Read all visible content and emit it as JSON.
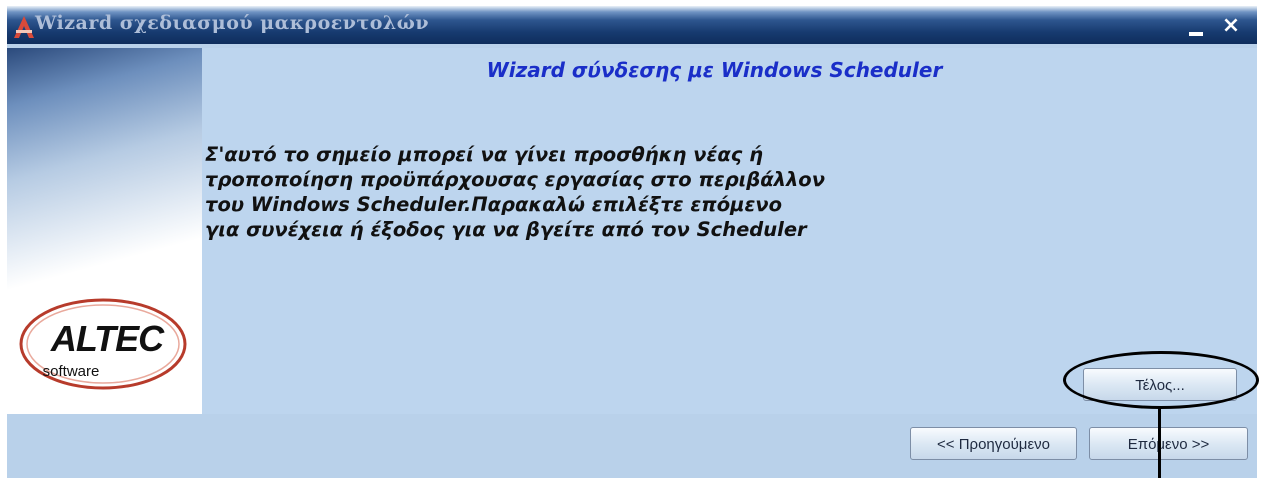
{
  "window": {
    "title": "Wizard σχεδιασμού μακροεντολών",
    "minimize_icon": "minimize-icon",
    "close_icon": "close-icon",
    "close_glyph": "×"
  },
  "logo": {
    "brand": "ALTEC",
    "sub": "software",
    "accent_color": "#c0392b"
  },
  "main": {
    "heading": "Wizard σύνδεσης με Windows Scheduler",
    "body_lines": [
      "Σ'αυτό το σημείο μπορεί να γίνει προσθήκη νέας ή",
      "τροποποίηση προϋπάρχουσας εργασίας στο περιβάλλον",
      "του Windows Scheduler.Παρακαλώ επιλέξτε επόμενο",
      "για συνέχεια ή έξοδος για να βγείτε από τον Scheduler"
    ]
  },
  "buttons": {
    "finish": "Τέλος...",
    "previous": "<< Προηγούμενο",
    "next": "Επόμενο >>"
  }
}
